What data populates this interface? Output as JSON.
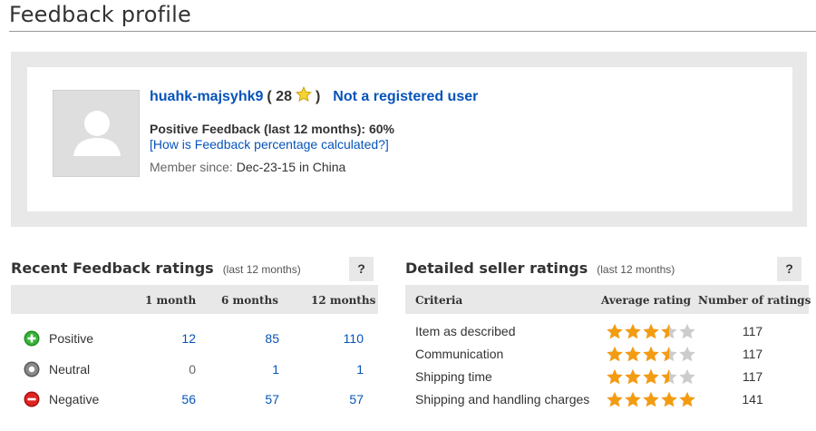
{
  "page": {
    "title": "Feedback profile"
  },
  "profile": {
    "username": "huahk-majsyhk9",
    "score_open": "( 28",
    "score_close": ")",
    "registration": "Not a registered user",
    "positive_feedback": "Positive Feedback (last 12 months): 60%",
    "calc_link": "[How is Feedback percentage calculated?]",
    "member_label": "Member since:",
    "member_value": "Dec-23-15 in China"
  },
  "recent": {
    "title": "Recent Feedback ratings",
    "subtitle": "(last 12 months)",
    "help": "?",
    "columns": [
      "1 month",
      "6 months",
      "12 months"
    ],
    "rows": [
      {
        "label": "Positive",
        "icon": "plus-circle-icon",
        "color": "#2aa52a",
        "values": [
          "12",
          "85",
          "110"
        ]
      },
      {
        "label": "Neutral",
        "icon": "neutral-circle-icon",
        "color": "#8a8a8a",
        "values": [
          "0",
          "1",
          "1"
        ]
      },
      {
        "label": "Negative",
        "icon": "minus-circle-icon",
        "color": "#d81c1c",
        "values": [
          "56",
          "57",
          "57"
        ]
      }
    ]
  },
  "detailed": {
    "title": "Detailed seller ratings",
    "subtitle": "(last 12 months)",
    "help": "?",
    "columns": [
      "Criteria",
      "Average rating",
      "Number of ratings"
    ],
    "rows": [
      {
        "label": "Item as described",
        "rating": 3.5,
        "count": "117"
      },
      {
        "label": "Communication",
        "rating": 3.5,
        "count": "117"
      },
      {
        "label": "Shipping time",
        "rating": 3.5,
        "count": "117"
      },
      {
        "label": "Shipping and handling charges",
        "rating": 5,
        "count": "141"
      }
    ]
  },
  "colors": {
    "link": "#0654ba",
    "star": "#f39c12",
    "star_empty": "#cccccc",
    "panel": "#e8e8e8"
  }
}
